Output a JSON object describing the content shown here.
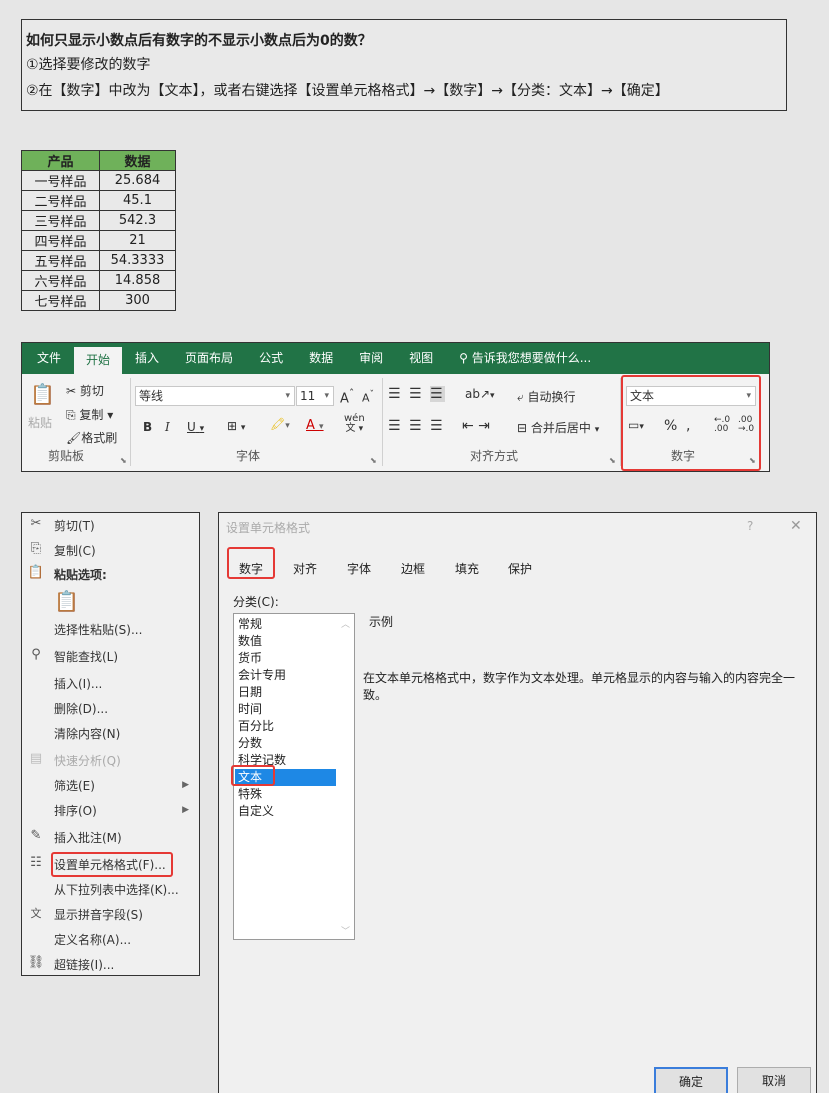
{
  "instructions": {
    "title": "如何只显示小数点后有数字的不显示小数点后为0的数？",
    "step1": "①选择要修改的数字",
    "step2": "②在【数字】中改为【文本】，或者右键选择【设置单元格格式】→【数字】→【分类：文本】→【确定】"
  },
  "table": {
    "headers": [
      "产品",
      "数据"
    ],
    "rows": [
      [
        "一号样品",
        "25.684"
      ],
      [
        "二号样品",
        "45.1"
      ],
      [
        "三号样品",
        "542.3"
      ],
      [
        "四号样品",
        "21"
      ],
      [
        "五号样品",
        "54.3333"
      ],
      [
        "六号样品",
        "14.858"
      ],
      [
        "七号样品",
        "300"
      ]
    ]
  },
  "ribbon": {
    "tabs": [
      "文件",
      "开始",
      "插入",
      "页面布局",
      "公式",
      "数据",
      "审阅",
      "视图"
    ],
    "tell_me": "告诉我您想要做什么...",
    "clipboard": {
      "paste": "粘贴",
      "cut": "剪切",
      "copy": "复制",
      "format_painter": "格式刷",
      "label": "剪贴板"
    },
    "font": {
      "name": "等线",
      "size": "11",
      "bold": "B",
      "italic": "I",
      "underline": "U",
      "label": "字体",
      "phonetic": "wén"
    },
    "alignment": {
      "wrap": "自动换行",
      "merge": "合并后居中",
      "label": "对齐方式"
    },
    "number": {
      "format": "文本",
      "percent": "%",
      "label": "数字",
      "inc_decimal": ".00",
      "dec_decimal": ".0"
    }
  },
  "context_menu": {
    "items": [
      {
        "label": "剪切(T)",
        "icon": "scissors-icon",
        "glyph": "✂"
      },
      {
        "label": "复制(C)",
        "icon": "copy-icon",
        "glyph": "⎘"
      },
      {
        "label": "粘贴选项:",
        "icon": "paste-icon",
        "glyph": "📋"
      },
      {
        "label": "选择性粘贴(S)..."
      },
      {
        "label": "智能查找(L)",
        "icon": "smart-lookup-icon",
        "glyph": "⚲"
      },
      {
        "label": "插入(I)..."
      },
      {
        "label": "删除(D)..."
      },
      {
        "label": "清除内容(N)"
      },
      {
        "label": "快速分析(Q)",
        "icon": "quick-analysis-icon",
        "glyph": "▤"
      },
      {
        "label": "筛选(E)"
      },
      {
        "label": "排序(O)"
      },
      {
        "label": "插入批注(M)",
        "icon": "comment-icon",
        "glyph": "✎"
      },
      {
        "label": "设置单元格格式(F)...",
        "icon": "format-cells-icon",
        "glyph": "☷"
      },
      {
        "label": "从下拉列表中选择(K)..."
      },
      {
        "label": "显示拼音字段(S)",
        "icon": "phonetic-icon",
        "glyph": "文"
      },
      {
        "label": "定义名称(A)..."
      },
      {
        "label": "超链接(I)...",
        "icon": "hyperlink-icon",
        "glyph": "⛓"
      }
    ]
  },
  "dialog": {
    "title": "设置单元格格式",
    "help": "?",
    "close": "✕",
    "tabs": [
      "数字",
      "对齐",
      "字体",
      "边框",
      "填充",
      "保护"
    ],
    "category_label": "分类(C):",
    "categories": [
      "常规",
      "数值",
      "货币",
      "会计专用",
      "日期",
      "时间",
      "百分比",
      "分数",
      "科学记数",
      "文本",
      "特殊",
      "自定义"
    ],
    "selected_category": "文本",
    "sample_label": "示例",
    "description": "在文本单元格格式中，数字作为文本处理。单元格显示的内容与输入的内容完全一致。",
    "ok": "确定",
    "cancel": "取消"
  },
  "colors": {
    "excel_green": "#217346",
    "header_green": "#6fb15a",
    "highlight_red": "#e53935",
    "selection_blue": "#1e88e5"
  }
}
